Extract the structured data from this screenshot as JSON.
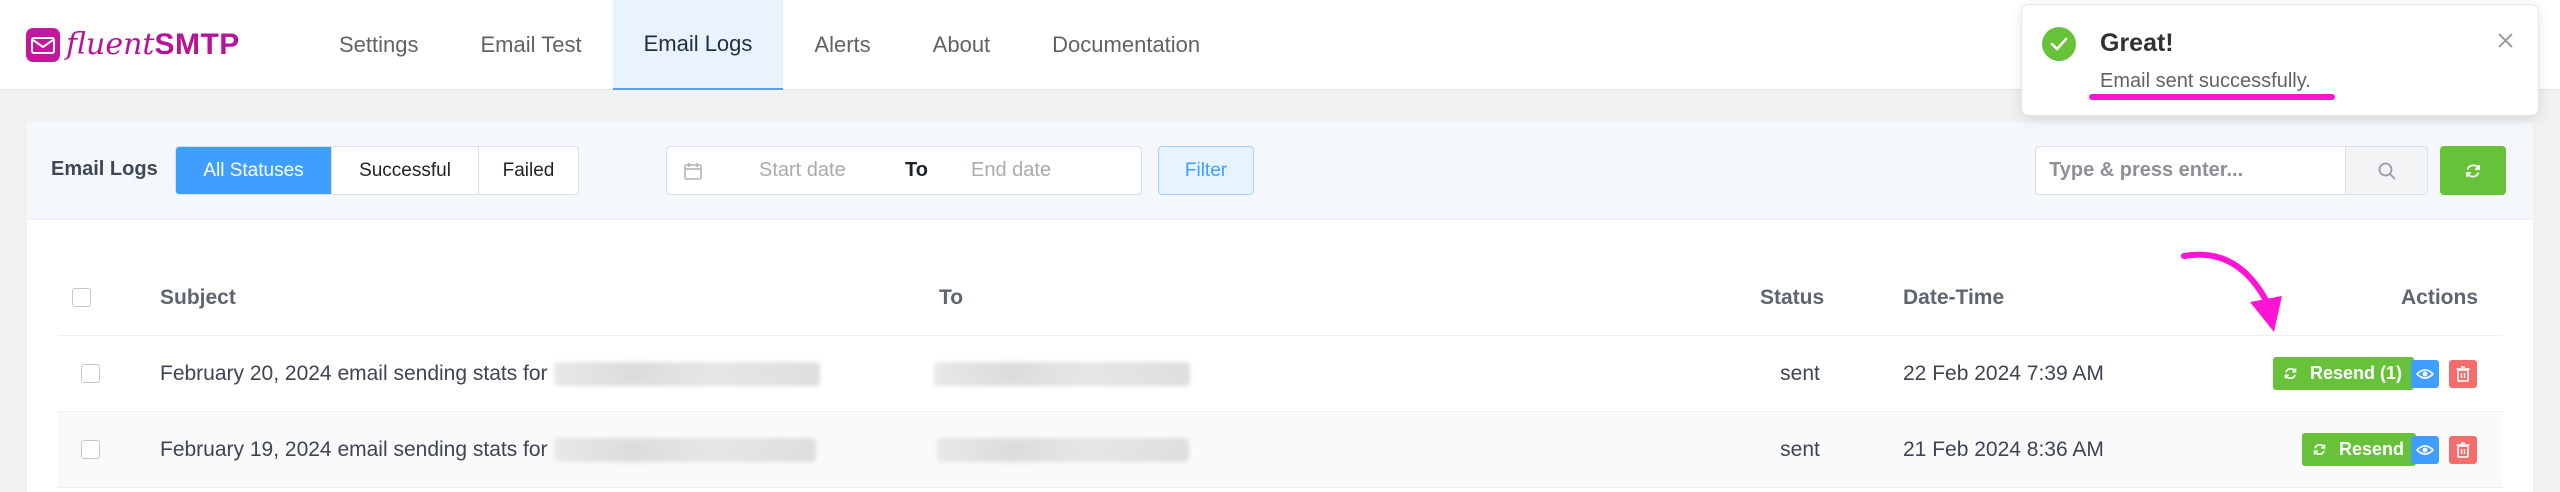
{
  "brand": {
    "name_part1": "fluent",
    "name_part2": "SMTP"
  },
  "nav": {
    "tabs": [
      {
        "label": "Settings"
      },
      {
        "label": "Email Test"
      },
      {
        "label": "Email Logs"
      },
      {
        "label": "Alerts"
      },
      {
        "label": "About"
      },
      {
        "label": "Documentation"
      }
    ],
    "active_tab": "Email Logs"
  },
  "toolbar": {
    "title": "Email Logs",
    "status_filters": [
      "All Statuses",
      "Successful",
      "Failed"
    ],
    "active_status": "All Statuses",
    "date_start_placeholder": "Start date",
    "date_separator": "To",
    "date_end_placeholder": "End date",
    "filter_label": "Filter",
    "search_placeholder": "Type & press enter..."
  },
  "table": {
    "columns": [
      "Subject",
      "To",
      "Status",
      "Date-Time",
      "Actions"
    ],
    "rows": [
      {
        "subject": "February 20, 2024 email sending stats for",
        "status": "sent",
        "datetime": "22 Feb 2024 7:39 AM",
        "resend_label": "Resend (1)"
      },
      {
        "subject": "February 19, 2024 email sending stats for",
        "status": "sent",
        "datetime": "21 Feb 2024 8:36 AM",
        "resend_label": "Resend"
      }
    ]
  },
  "toast": {
    "title": "Great!",
    "message": "Email sent successfully."
  },
  "colors": {
    "brand": "#b6129a",
    "primary": "#409eff",
    "success": "#67c23a",
    "danger": "#f56c6c",
    "annotation": "#ff14d6"
  }
}
